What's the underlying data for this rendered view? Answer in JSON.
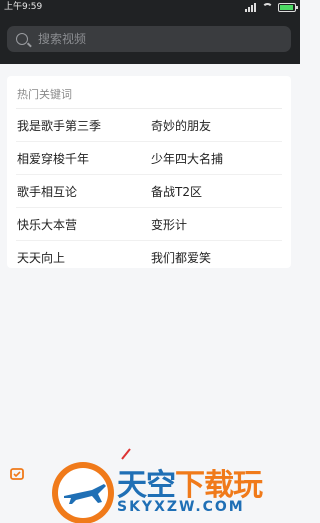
{
  "status_bar": {
    "time": "上午9:59"
  },
  "search": {
    "placeholder": "搜索视频"
  },
  "hot_keywords": {
    "title": "热门关键词",
    "rows": [
      {
        "left": "我是歌手第三季",
        "right": "奇妙的朋友"
      },
      {
        "left": "相爱穿梭千年",
        "right": "少年四大名捕"
      },
      {
        "left": "歌手相互论",
        "right": "备战T2区"
      },
      {
        "left": "快乐大本营",
        "right": "变形计"
      },
      {
        "left": "天天向上",
        "right": "我们都爱笑"
      }
    ]
  },
  "watermark": {
    "title_blue": "天空",
    "title_orange": "下载玩",
    "subtitle": "SKYXZW.COM"
  },
  "colors": {
    "header_bg": "#202224",
    "search_bg": "#3a3c3f",
    "page_bg": "#f5f6f8",
    "brand_blue": "#1f6fb5",
    "brand_orange": "#f07a1a"
  }
}
